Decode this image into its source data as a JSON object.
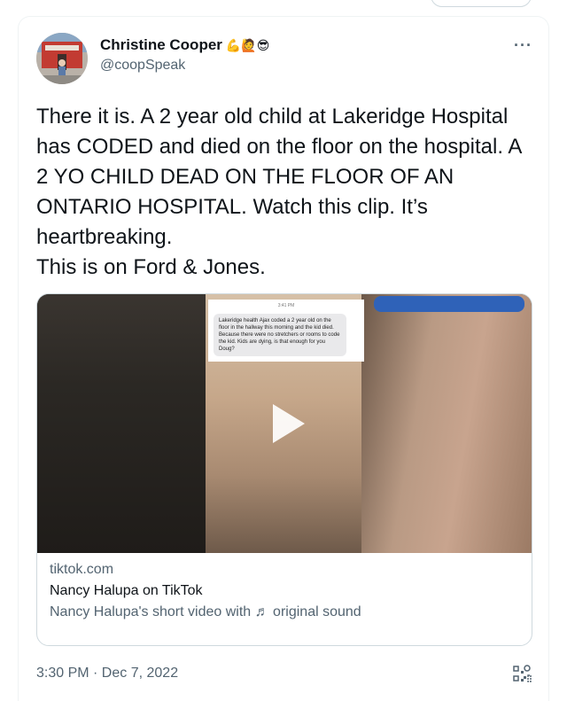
{
  "tweet": {
    "author_name": "Christine Cooper",
    "author_emojis": "💪🙋😎",
    "author_handle": "@coopSpeak",
    "more_icon": "more-horizontal-icon",
    "text": "There it is. A 2 year old child at Lakeridge Hospital has CODED and died on the floor on the hospital. A 2 YO CHILD DEAD ON THE FLOOR OF AN ONTARIO HOSPITAL. Watch this clip. It’s heartbreaking.\nThis is on Ford & Jones.",
    "timestamp": "3:30 PM · Dec 7, 2022"
  },
  "link_card": {
    "domain": "tiktok.com",
    "title": "Nancy Halupa on TikTok",
    "description": "Nancy Halupa's short video with ♬ original sound",
    "media": {
      "phone_time": "3:41 PM",
      "message": "Lakeridge health Ajax coded a 2 year old on the floor in the hallway this morning and the kid died. Because there were no stretchers or rooms to code the kid. Kids are dying, is that enough for you Doug?",
      "play_icon": "play-icon"
    }
  },
  "colors": {
    "text_primary": "#0f1419",
    "text_secondary": "#536471",
    "border": "#cfd9de"
  }
}
